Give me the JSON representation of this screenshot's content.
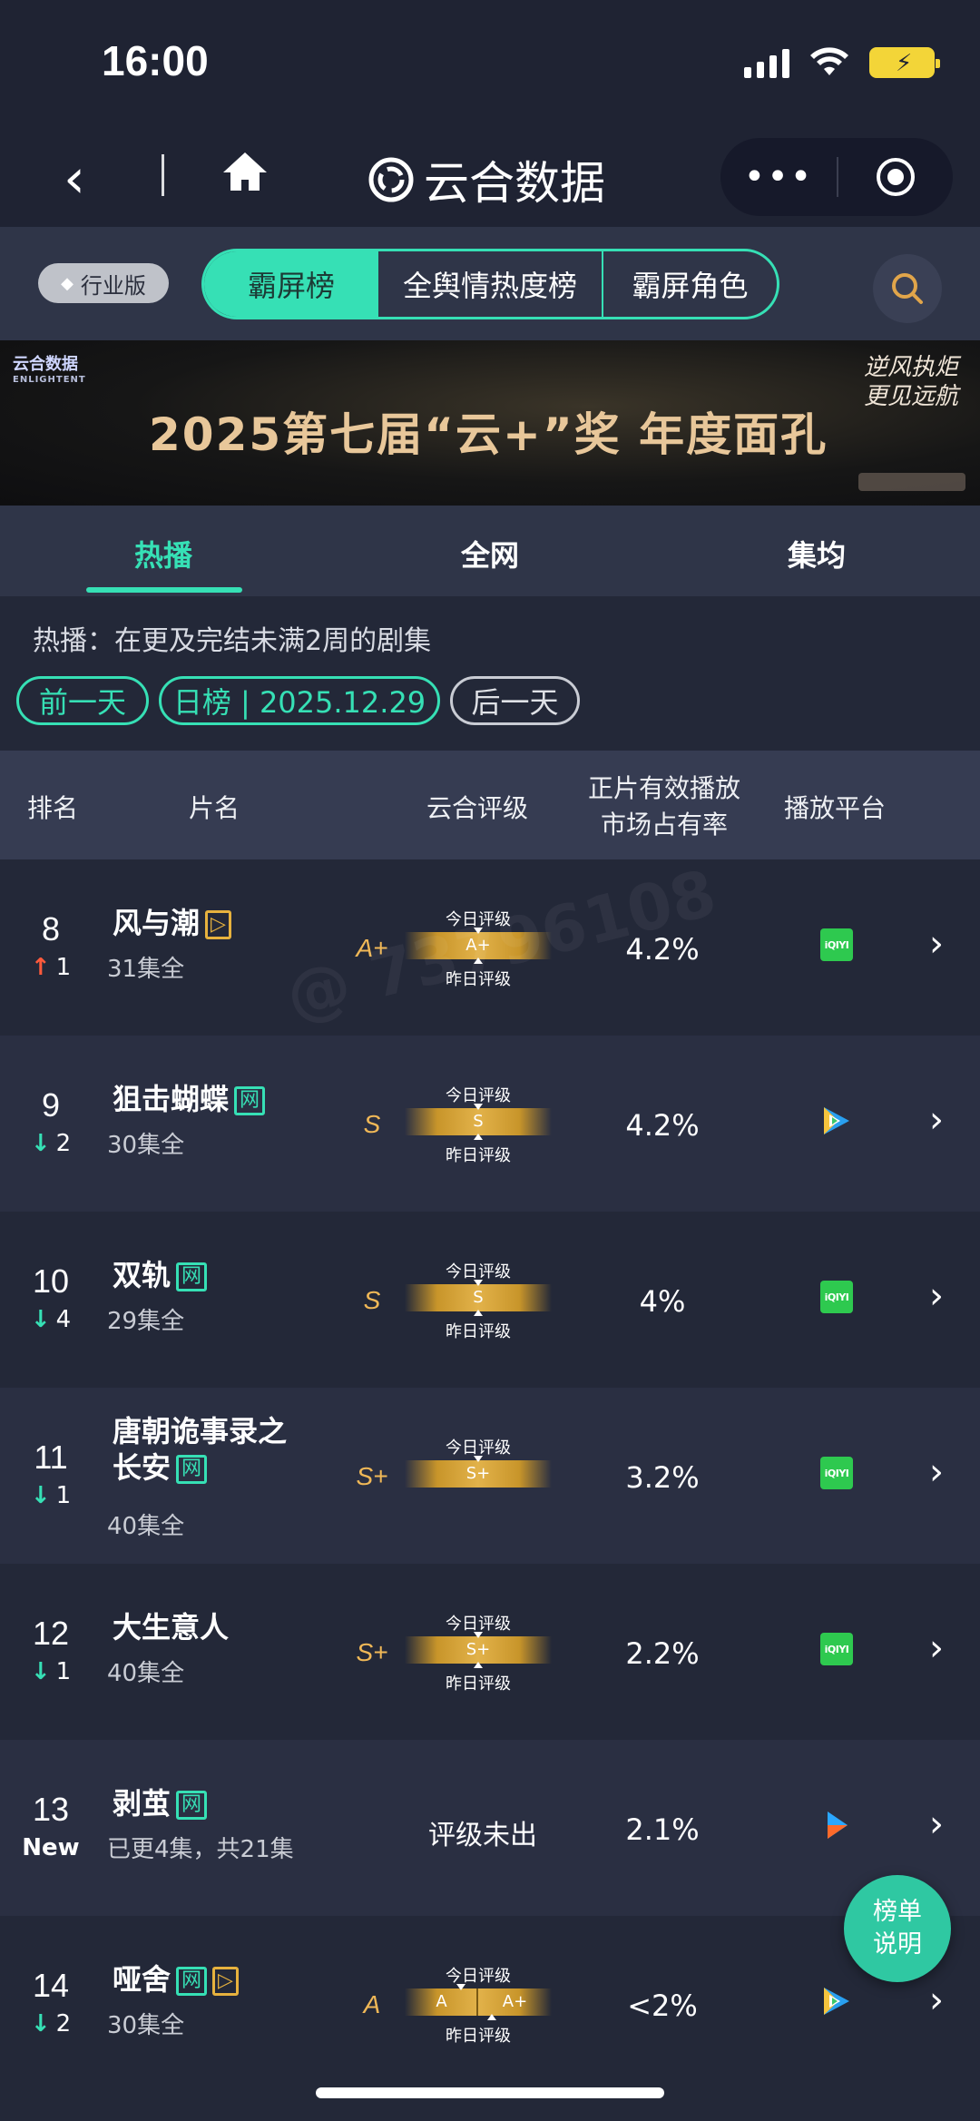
{
  "status_bar": {
    "time": "16:00"
  },
  "nav": {
    "back": "‹",
    "title": "云合数据",
    "more": "•••"
  },
  "top_tabs": {
    "edition": "行业版",
    "segments": [
      "霸屏榜",
      "全舆情热度榜",
      "霸屏角色"
    ],
    "active_segment": "霸屏榜"
  },
  "banner": {
    "brand": "云合数据",
    "brand_en": "ENLIGHTENT",
    "headline": "2025第七届“云+”奖  年度面孔",
    "slogan_line1": "逆风执炬",
    "slogan_line2": "更见远航"
  },
  "section_tabs": [
    "热播",
    "全网",
    "集均"
  ],
  "info": {
    "description": "热播：在更及完结未满2周的剧集",
    "prev_day": "前一天",
    "date_label": "日榜 | 2025.12.29",
    "next_day": "后一天"
  },
  "table_header": {
    "rank": "排名",
    "name": "片名",
    "rating": "云合评级",
    "share_line1": "正片有效播放",
    "share_line2": "市场占有率",
    "platform": "播放平台"
  },
  "gauge_labels": {
    "today": "今日评级",
    "yesterday": "昨日评级"
  },
  "rows": [
    {
      "rank": "8",
      "change_dir": "up",
      "change": "1",
      "name": "风与潮",
      "tags": [
        "gold"
      ],
      "eps": "31集全",
      "rating": "A+",
      "today": "A+",
      "yesterday": "",
      "share": "4.2%",
      "platform": "iqiyi",
      "platform_label": "iQIYI"
    },
    {
      "rank": "9",
      "change_dir": "down",
      "change": "2",
      "name": "狙击蝴蝶",
      "tags": [
        "网"
      ],
      "eps": "30集全",
      "rating": "S",
      "today": "S",
      "yesterday": "",
      "share": "4.2%",
      "platform": "tencent",
      "platform_label": ""
    },
    {
      "rank": "10",
      "change_dir": "down",
      "change": "4",
      "name": "双轨",
      "tags": [
        "网"
      ],
      "eps": "29集全",
      "rating": "S",
      "today": "S",
      "yesterday": "",
      "share": "4%",
      "platform": "iqiyi",
      "platform_label": "iQIYI"
    },
    {
      "rank": "11",
      "change_dir": "down",
      "change": "1",
      "name": "唐朝诡事录之长安",
      "tags": [
        "网"
      ],
      "eps": "40集全",
      "rating": "S+",
      "today": "S+",
      "yesterday": "",
      "share": "3.2%",
      "platform": "iqiyi",
      "platform_label": "iQIYI"
    },
    {
      "rank": "12",
      "change_dir": "down",
      "change": "1",
      "name": "大生意人",
      "tags": [],
      "eps": "40集全",
      "rating": "S+",
      "today": "S+",
      "yesterday": "",
      "share": "2.2%",
      "platform": "iqiyi",
      "platform_label": "iQIYI"
    },
    {
      "rank": "13",
      "change_dir": "new",
      "change": "New",
      "name": "剥茧",
      "tags": [
        "网"
      ],
      "eps": "已更4集，共21集",
      "rating": "",
      "rating_text": "评级未出",
      "share": "2.1%",
      "platform": "youku",
      "platform_label": ""
    },
    {
      "rank": "14",
      "change_dir": "down",
      "change": "2",
      "name": "哑舍",
      "tags": [
        "网",
        "gold"
      ],
      "eps": "30集全",
      "rating": "A",
      "today": "A",
      "yesterday": "A+",
      "share": "<2%",
      "platform": "tencent",
      "platform_label": ""
    }
  ],
  "fab": {
    "line1": "榜单",
    "line2": "说明"
  },
  "watermark": "@ 73796108",
  "colors": {
    "accent": "#36e0b5",
    "rating_gold": "#f0b857",
    "up": "#ff5a3c",
    "down": "#36e0b5"
  }
}
